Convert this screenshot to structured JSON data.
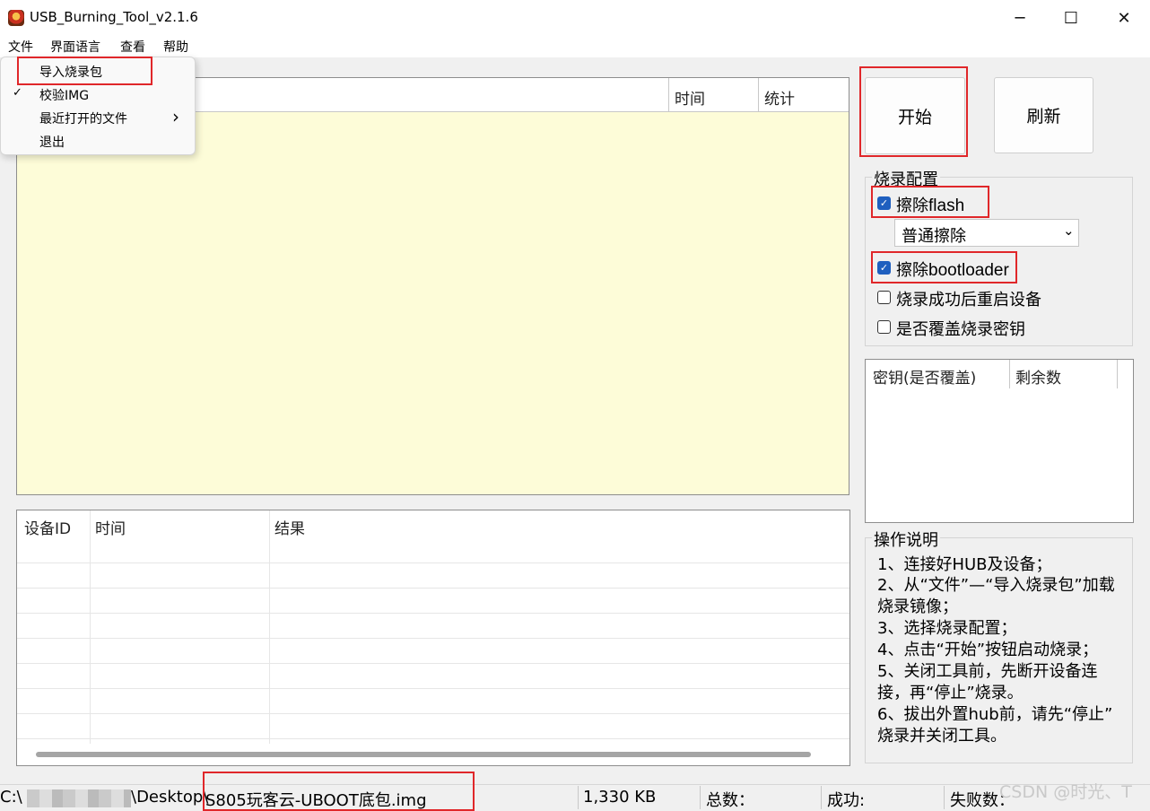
{
  "window": {
    "title": "USB_Burning_Tool_v2.1.6",
    "minimize_glyph": "─",
    "maximize_glyph": "☐",
    "close_glyph": "✕"
  },
  "menubar": {
    "items": [
      "文件",
      "界面语言",
      "查看",
      "帮助"
    ]
  },
  "file_menu": {
    "items": [
      {
        "label": "导入烧录包",
        "checked": false,
        "submenu": false,
        "highlighted": true
      },
      {
        "label": "校验IMG",
        "checked": true,
        "submenu": false
      },
      {
        "label": "最近打开的文件",
        "checked": false,
        "submenu": true
      },
      {
        "label": "退出",
        "checked": false,
        "submenu": false
      }
    ],
    "check_glyph": "✓",
    "submenu_glyph": "›"
  },
  "device_table": {
    "columns": [
      "时间",
      "统计"
    ],
    "background": "#fdfcd8"
  },
  "log_table": {
    "columns": [
      "设备ID",
      "时间",
      "结果"
    ],
    "row_count": 8
  },
  "buttons": {
    "start": "开始",
    "refresh": "刷新"
  },
  "burn_config": {
    "title": "烧录配置",
    "erase_flash": {
      "prefix": "擦除",
      "suffix": "flash",
      "checked": true
    },
    "erase_mode": {
      "selected": "普通擦除",
      "arrow": "⌄"
    },
    "erase_bootloader": {
      "prefix": "擦除",
      "suffix": "bootloader",
      "checked": true
    },
    "reboot_after": {
      "label": "烧录成功后重启设备",
      "checked": false
    },
    "overwrite_key": {
      "label": "是否覆盖烧录密钥",
      "checked": false
    }
  },
  "key_table": {
    "columns": [
      "密钥(是否覆盖)",
      "剩余数"
    ]
  },
  "instructions": {
    "title": "操作说明",
    "lines": [
      "1、连接好HUB及设备；",
      "2、从“文件”—“导入烧录包”加载",
      "烧录镜像；",
      "3、选择烧录配置；",
      "4、点击“开始”按钮启动烧录；",
      "5、关闭工具前，先断开设备连",
      "接，再“停止”烧录。",
      "6、拔出外置hub前，请先“停止”",
      "烧录并关闭工具。"
    ]
  },
  "statusbar": {
    "path_prefix": "C:\\",
    "path_mid": "\\Desktop\\",
    "file_name": "S805玩客云-UBOOT底包.img",
    "file_size": "1,330 KB",
    "total_label": "总数：",
    "success_label": "成功:",
    "fail_label": "失败数：",
    "watermark": "CSDN @时光、T"
  },
  "colors": {
    "highlight_red": "#e0272a",
    "checkbox_blue": "#1f5fbf"
  }
}
